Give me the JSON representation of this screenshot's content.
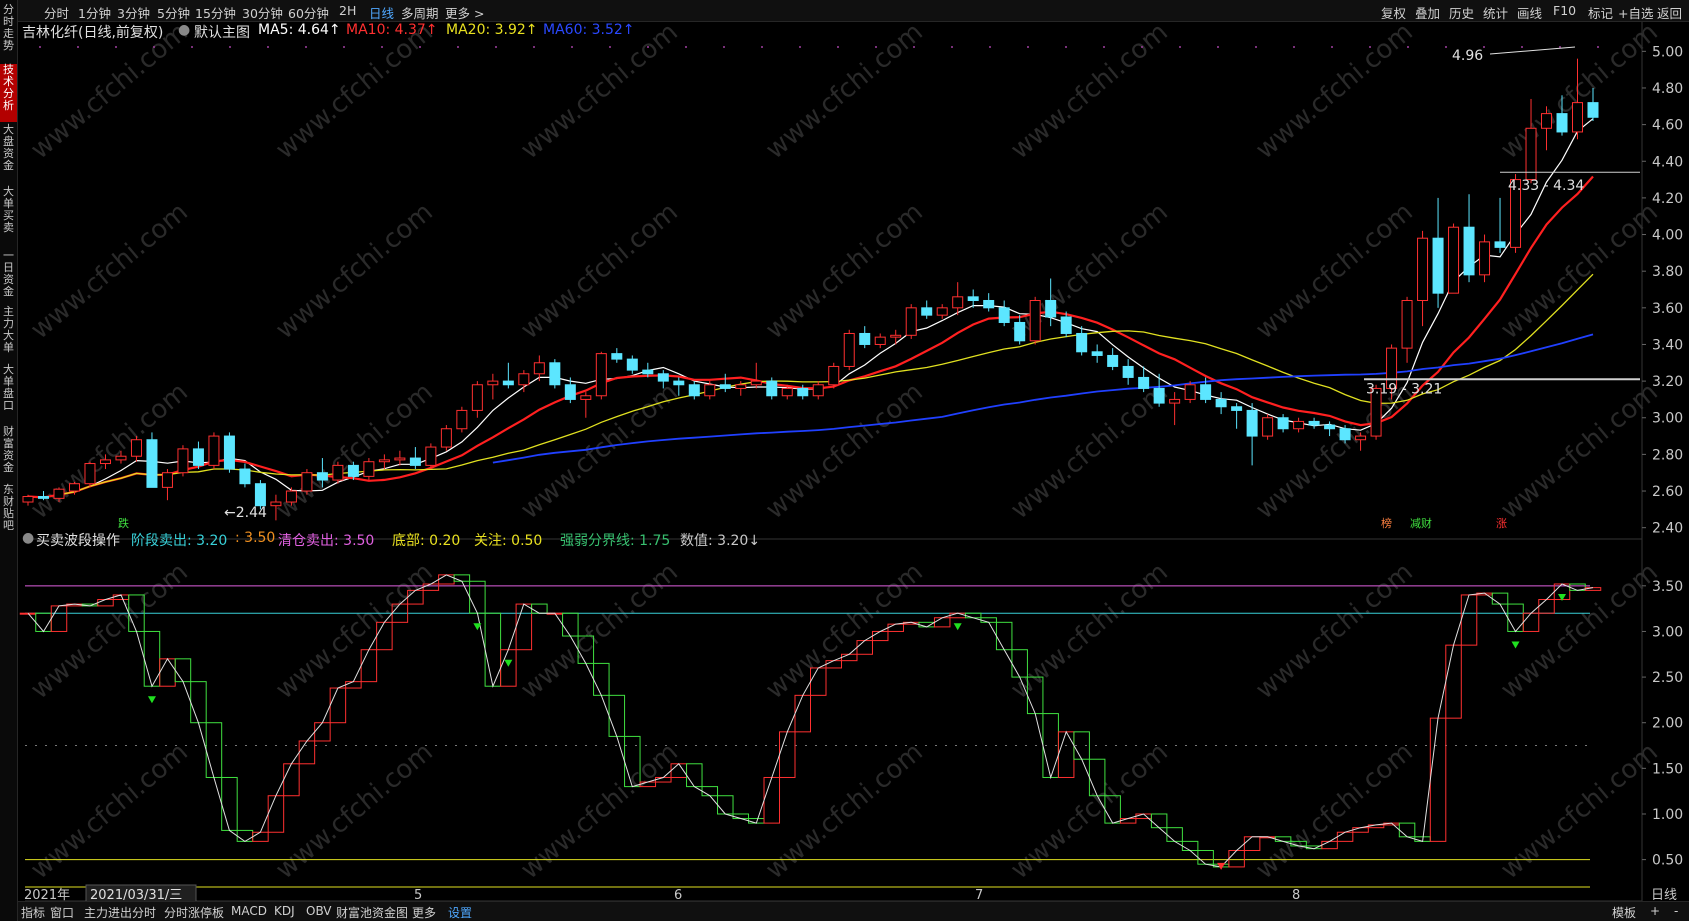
{
  "topbar": {
    "periods": [
      "分时",
      "1分钟",
      "3分钟",
      "5分钟",
      "15分钟",
      "30分钟",
      "60分钟",
      "2H",
      "日线",
      "多周期",
      "更多 >"
    ],
    "active_period": "日线",
    "right_tools": [
      "复权",
      "叠加",
      "历史",
      "统计",
      "画线",
      "F10",
      "标记",
      "+自选",
      "返回"
    ]
  },
  "leftnav": [
    "分时走势",
    "技术分析",
    "大盘资金",
    "大单买卖",
    "一日资金",
    "主力大单",
    "大单盘口",
    "财富资金",
    "东财贴吧"
  ],
  "leftnav_active": "技术分析",
  "main_legend": {
    "title": "吉林化纤(日线,前复权)",
    "template": "默认主图",
    "ma5": "MA5: 4.64↑",
    "ma10": "MA10: 4.37↑",
    "ma20": "MA20: 3.92↑",
    "ma60": "MA60: 3.52↑"
  },
  "price_annotations": {
    "high": "4.96",
    "low": "←2.44",
    "upper_gap": "4.33 - 4.34",
    "lower_gap": "3.19 - 3.21"
  },
  "event_tags": [
    "跌",
    "榜",
    "减财",
    "涨"
  ],
  "indicator_legend": {
    "name": "买卖波段操作",
    "stage_sell_label": "阶段卖出: 3.20",
    "stage_sell_value": ": 3.50",
    "clear_sell": "清仓卖出: 3.50",
    "bottom": "底部: 0.20",
    "watch": "关注: 0.50",
    "divider": "强弱分界线: 1.75",
    "value": "数值: 3.20↓"
  },
  "axis": {
    "price_ticks": [
      "5.00",
      "4.80",
      "4.60",
      "4.40",
      "4.20",
      "4.00",
      "3.80",
      "3.60",
      "3.40",
      "3.20",
      "3.00",
      "2.80",
      "2.60",
      "2.40"
    ],
    "indicator_ticks": [
      "3.50",
      "3.00",
      "2.50",
      "2.00",
      "1.50",
      "1.00",
      "0.50"
    ],
    "year": "2021年",
    "cursor_date": "2021/03/31/三",
    "months": [
      "5",
      "6",
      "7",
      "8"
    ],
    "period_label": "日线"
  },
  "bottombar": {
    "tabs": [
      "指标",
      "窗口",
      "主力进出分时",
      "分时涨停板",
      "MACD",
      "KDJ",
      "OBV",
      "财富池资金图",
      "更多",
      "设置"
    ],
    "active_tab": "设置",
    "right": [
      "模板",
      "+",
      "-"
    ]
  },
  "watermark": "www.cfchi.com",
  "colors": {
    "up": "#ff3030",
    "down": "#5ce6ff",
    "ma5": "#ffffff",
    "ma10": "#ff2020",
    "ma20": "#e0e020",
    "ma60": "#2040ff",
    "active": "#4fa8ff"
  },
  "chart_data": {
    "type": "candlestick",
    "days": 102,
    "ohlc": [
      [
        2.54,
        2.58,
        2.52,
        2.57
      ],
      [
        2.57,
        2.6,
        2.55,
        2.56
      ],
      [
        2.56,
        2.62,
        2.54,
        2.61
      ],
      [
        2.6,
        2.65,
        2.58,
        2.64
      ],
      [
        2.64,
        2.76,
        2.62,
        2.75
      ],
      [
        2.75,
        2.8,
        2.72,
        2.77
      ],
      [
        2.77,
        2.82,
        2.75,
        2.79
      ],
      [
        2.79,
        2.9,
        2.76,
        2.88
      ],
      [
        2.88,
        2.92,
        2.7,
        2.62
      ],
      [
        2.62,
        2.72,
        2.55,
        2.7
      ],
      [
        2.7,
        2.85,
        2.68,
        2.83
      ],
      [
        2.83,
        2.87,
        2.72,
        2.74
      ],
      [
        2.74,
        2.92,
        2.72,
        2.9
      ],
      [
        2.9,
        2.92,
        2.7,
        2.72
      ],
      [
        2.72,
        2.75,
        2.62,
        2.64
      ],
      [
        2.64,
        2.66,
        2.5,
        2.52
      ],
      [
        2.52,
        2.58,
        2.44,
        2.54
      ],
      [
        2.54,
        2.62,
        2.52,
        2.6
      ],
      [
        2.6,
        2.72,
        2.58,
        2.7
      ],
      [
        2.7,
        2.78,
        2.62,
        2.66
      ],
      [
        2.66,
        2.76,
        2.64,
        2.74
      ],
      [
        2.74,
        2.76,
        2.66,
        2.68
      ],
      [
        2.68,
        2.78,
        2.66,
        2.76
      ],
      [
        2.76,
        2.8,
        2.72,
        2.77
      ],
      [
        2.77,
        2.82,
        2.74,
        2.78
      ],
      [
        2.78,
        2.84,
        2.72,
        2.74
      ],
      [
        2.74,
        2.86,
        2.72,
        2.84
      ],
      [
        2.84,
        2.96,
        2.82,
        2.94
      ],
      [
        2.94,
        3.06,
        2.92,
        3.04
      ],
      [
        3.04,
        3.2,
        3.0,
        3.18
      ],
      [
        3.18,
        3.24,
        3.1,
        3.2
      ],
      [
        3.2,
        3.3,
        3.16,
        3.18
      ],
      [
        3.18,
        3.26,
        3.14,
        3.24
      ],
      [
        3.24,
        3.34,
        3.2,
        3.3
      ],
      [
        3.3,
        3.32,
        3.16,
        3.18
      ],
      [
        3.18,
        3.22,
        3.08,
        3.1
      ],
      [
        3.1,
        3.14,
        3.0,
        3.12
      ],
      [
        3.12,
        3.36,
        3.1,
        3.35
      ],
      [
        3.35,
        3.38,
        3.3,
        3.32
      ],
      [
        3.32,
        3.34,
        3.24,
        3.26
      ],
      [
        3.26,
        3.3,
        3.22,
        3.24
      ],
      [
        3.24,
        3.26,
        3.16,
        3.2
      ],
      [
        3.2,
        3.22,
        3.12,
        3.18
      ],
      [
        3.18,
        3.2,
        3.1,
        3.12
      ],
      [
        3.12,
        3.2,
        3.1,
        3.18
      ],
      [
        3.18,
        3.24,
        3.14,
        3.16
      ],
      [
        3.16,
        3.2,
        3.12,
        3.18
      ],
      [
        3.18,
        3.3,
        3.16,
        3.2
      ],
      [
        3.2,
        3.22,
        3.1,
        3.12
      ],
      [
        3.12,
        3.18,
        3.1,
        3.16
      ],
      [
        3.16,
        3.18,
        3.1,
        3.12
      ],
      [
        3.12,
        3.2,
        3.1,
        3.18
      ],
      [
        3.18,
        3.3,
        3.16,
        3.28
      ],
      [
        3.28,
        3.48,
        3.26,
        3.46
      ],
      [
        3.46,
        3.5,
        3.38,
        3.4
      ],
      [
        3.4,
        3.46,
        3.38,
        3.44
      ],
      [
        3.44,
        3.48,
        3.4,
        3.45
      ],
      [
        3.45,
        3.62,
        3.43,
        3.6
      ],
      [
        3.6,
        3.64,
        3.54,
        3.56
      ],
      [
        3.56,
        3.62,
        3.54,
        3.6
      ],
      [
        3.6,
        3.74,
        3.56,
        3.66
      ],
      [
        3.66,
        3.7,
        3.6,
        3.64
      ],
      [
        3.64,
        3.68,
        3.58,
        3.6
      ],
      [
        3.6,
        3.64,
        3.5,
        3.52
      ],
      [
        3.52,
        3.56,
        3.4,
        3.42
      ],
      [
        3.42,
        3.66,
        3.4,
        3.64
      ],
      [
        3.64,
        3.76,
        3.5,
        3.55
      ],
      [
        3.55,
        3.58,
        3.44,
        3.46
      ],
      [
        3.46,
        3.5,
        3.34,
        3.36
      ],
      [
        3.36,
        3.4,
        3.3,
        3.34
      ],
      [
        3.34,
        3.38,
        3.26,
        3.28
      ],
      [
        3.28,
        3.32,
        3.18,
        3.22
      ],
      [
        3.22,
        3.28,
        3.14,
        3.16
      ],
      [
        3.16,
        3.24,
        3.06,
        3.08
      ],
      [
        3.08,
        3.14,
        2.96,
        3.1
      ],
      [
        3.1,
        3.2,
        3.08,
        3.18
      ],
      [
        3.18,
        3.22,
        3.08,
        3.1
      ],
      [
        3.1,
        3.14,
        3.02,
        3.06
      ],
      [
        3.06,
        3.08,
        2.94,
        3.04
      ],
      [
        3.04,
        3.08,
        2.74,
        2.9
      ],
      [
        2.9,
        3.02,
        2.88,
        3.0
      ],
      [
        3.0,
        3.02,
        2.92,
        2.94
      ],
      [
        2.94,
        3.0,
        2.92,
        2.98
      ],
      [
        2.98,
        3.0,
        2.94,
        2.96
      ],
      [
        2.96,
        2.98,
        2.9,
        2.94
      ],
      [
        2.94,
        2.96,
        2.86,
        2.88
      ],
      [
        2.88,
        2.92,
        2.82,
        2.9
      ],
      [
        2.9,
        3.18,
        2.88,
        3.16
      ],
      [
        3.16,
        3.4,
        3.1,
        3.38
      ],
      [
        3.38,
        3.66,
        3.3,
        3.64
      ],
      [
        3.64,
        4.02,
        3.5,
        3.98
      ],
      [
        3.98,
        4.2,
        3.6,
        3.68
      ],
      [
        3.68,
        4.06,
        3.68,
        4.04
      ],
      [
        4.04,
        4.22,
        3.74,
        3.78
      ],
      [
        3.78,
        4.0,
        3.74,
        3.96
      ],
      [
        3.96,
        4.2,
        3.9,
        3.93
      ],
      [
        3.93,
        4.33,
        3.9,
        4.3
      ],
      [
        4.3,
        4.74,
        4.28,
        4.58
      ],
      [
        4.58,
        4.7,
        4.46,
        4.66
      ],
      [
        4.66,
        4.76,
        4.54,
        4.56
      ],
      [
        4.56,
        4.96,
        4.52,
        4.72
      ],
      [
        4.72,
        4.8,
        4.62,
        4.64
      ]
    ],
    "ma_periods": [
      5,
      10,
      20,
      60
    ],
    "ylim": [
      2.36,
      5.04
    ],
    "indicator": {
      "values": [
        3.2,
        3.0,
        3.28,
        3.3,
        3.28,
        3.35,
        3.4,
        3.0,
        2.4,
        2.7,
        2.45,
        2.0,
        1.4,
        0.82,
        0.7,
        0.8,
        1.2,
        1.55,
        1.8,
        2.0,
        2.38,
        2.45,
        2.8,
        3.1,
        3.3,
        3.45,
        3.52,
        3.62,
        3.55,
        3.2,
        2.4,
        2.8,
        3.3,
        3.2,
        3.2,
        2.95,
        2.65,
        2.3,
        1.85,
        1.3,
        1.35,
        1.4,
        1.55,
        1.3,
        1.2,
        1.0,
        0.95,
        0.9,
        1.4,
        1.9,
        2.3,
        2.6,
        2.68,
        2.75,
        2.9,
        3.0,
        3.08,
        3.1,
        3.05,
        3.15,
        3.2,
        3.15,
        3.1,
        2.8,
        2.5,
        2.1,
        1.4,
        1.9,
        1.6,
        1.2,
        0.9,
        0.95,
        1.0,
        0.85,
        0.7,
        0.6,
        0.45,
        0.42,
        0.6,
        0.75,
        0.75,
        0.7,
        0.65,
        0.62,
        0.7,
        0.8,
        0.85,
        0.88,
        0.9,
        0.75,
        0.7,
        2.05,
        2.85,
        3.4,
        3.42,
        3.3,
        3.0,
        3.2,
        3.35,
        3.52,
        3.45,
        3.48
      ],
      "lines": {
        "clear_sell": 3.5,
        "stage_sell": 3.2,
        "divider": 1.75,
        "watch": 0.5,
        "bottom": 0.2
      },
      "ylim": [
        0.2,
        3.75
      ]
    }
  }
}
